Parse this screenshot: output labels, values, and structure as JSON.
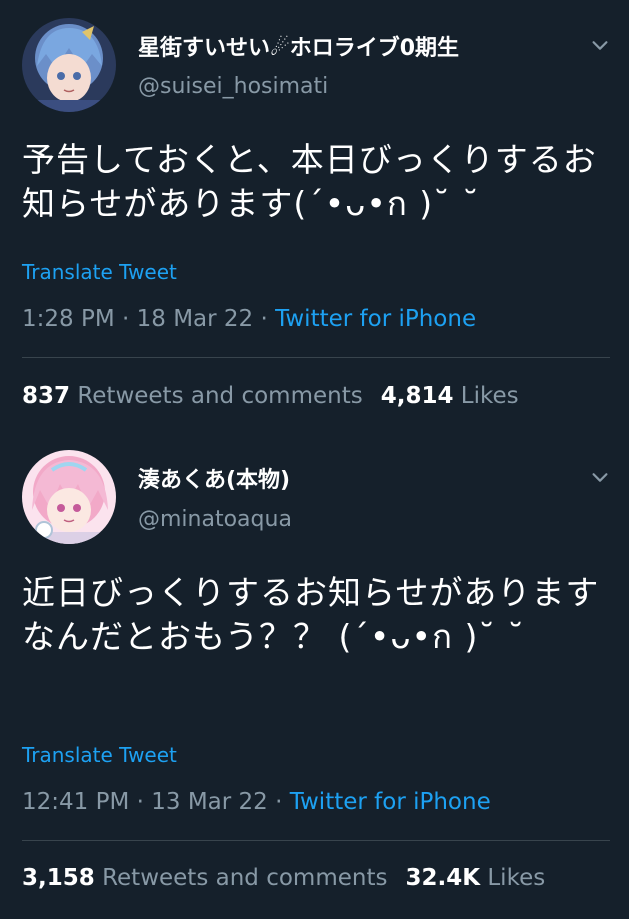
{
  "tweets": [
    {
      "display_name": "星街すいせい☄ホロライブ0期生",
      "handle": "@suisei_hosimati",
      "text": "予告しておくと、本日びっくりするお知らせがあります(´•ᴗ•ก )˘ ˘",
      "translate_label": "Translate Tweet",
      "time": "1:28 PM",
      "date": "18 Mar 22",
      "source": "Twitter for iPhone",
      "retweets_count": "837",
      "retweets_label": "Retweets and comments",
      "likes_count": "4,814",
      "likes_label": "Likes",
      "avatar_color": "#6b8fc9"
    },
    {
      "display_name": "湊あくあ(本物)",
      "handle": "@minatoaqua",
      "text": "近日びっくりするお知らせがあります\nなんだとおもう？？ (´•ᴗ•ก )˘ ˘",
      "translate_label": "Translate Tweet",
      "time": "12:41 PM",
      "date": "13 Mar 22",
      "source": "Twitter for iPhone",
      "retweets_count": "3,158",
      "retweets_label": "Retweets and comments",
      "likes_count": "32.4K",
      "likes_label": "Likes",
      "avatar_color": "#f2a9c8"
    }
  ],
  "separator": " · ",
  "icons": {
    "chevron": "chevron-down-icon"
  },
  "colors": {
    "background": "#15202b",
    "accent": "#1da1f2",
    "muted": "#8899a6",
    "divider": "#38444d"
  }
}
